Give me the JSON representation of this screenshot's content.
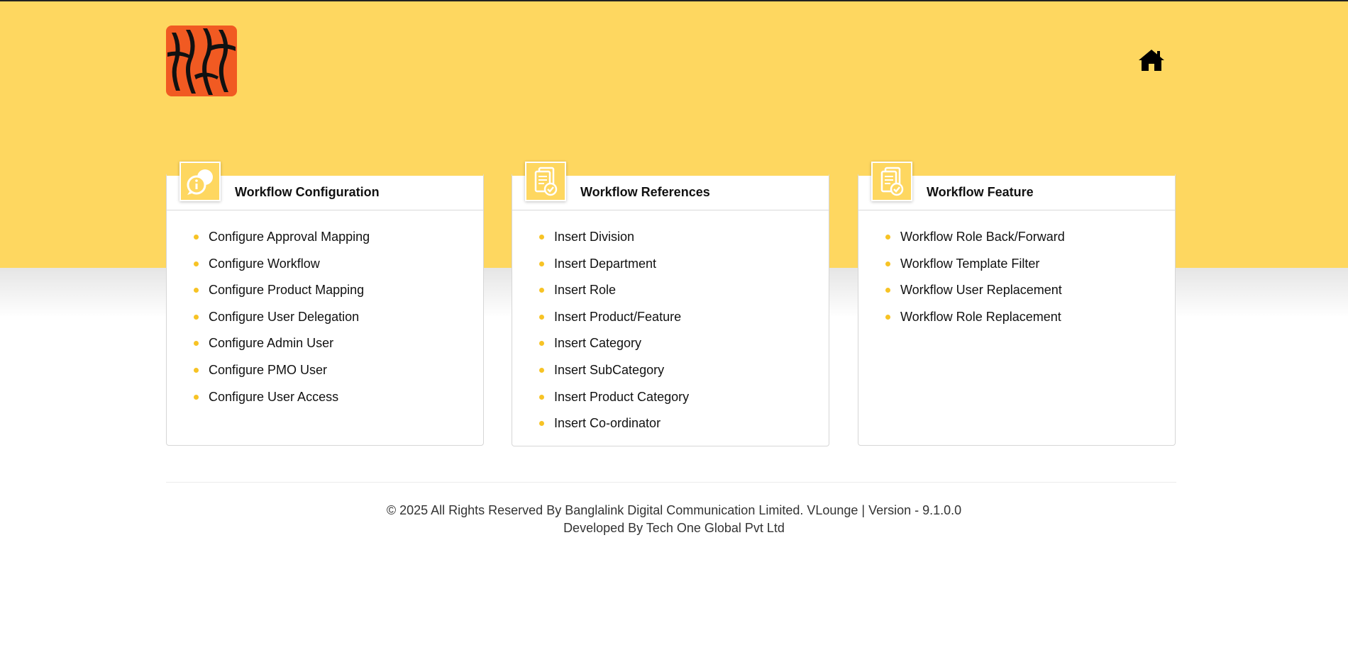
{
  "header": {
    "logo_name": "banglalink-tiger-logo",
    "home_icon": "home-icon"
  },
  "colors": {
    "brand_yellow": "#fed760",
    "bullet": "#f7c325",
    "logo_orange": "#f15a22"
  },
  "cards": [
    {
      "title": "Workflow Configuration",
      "icon": "chat-info-icon",
      "items": [
        "Configure Approval Mapping",
        "Configure Workflow",
        "Configure Product Mapping",
        "Configure User Delegation",
        "Configure Admin User",
        "Configure PMO User",
        "Configure User Access"
      ]
    },
    {
      "title": "Workflow References",
      "icon": "document-check-icon",
      "items": [
        "Insert Division",
        "Insert Department",
        "Insert Role",
        "Insert Product/Feature",
        "Insert Category",
        "Insert SubCategory",
        "Insert Product Category",
        "Insert Co-ordinator"
      ]
    },
    {
      "title": "Workflow Feature",
      "icon": "document-check-icon",
      "items": [
        "Workflow Role Back/Forward",
        "Workflow Template Filter",
        "Workflow User Replacement",
        "Workflow Role Replacement"
      ]
    }
  ],
  "footer": {
    "line1": "© 2025 All Rights Reserved By Banglalink Digital Communication Limited. VLounge | Version - 9.1.0.0",
    "line2": "Developed By Tech One Global Pvt Ltd"
  }
}
